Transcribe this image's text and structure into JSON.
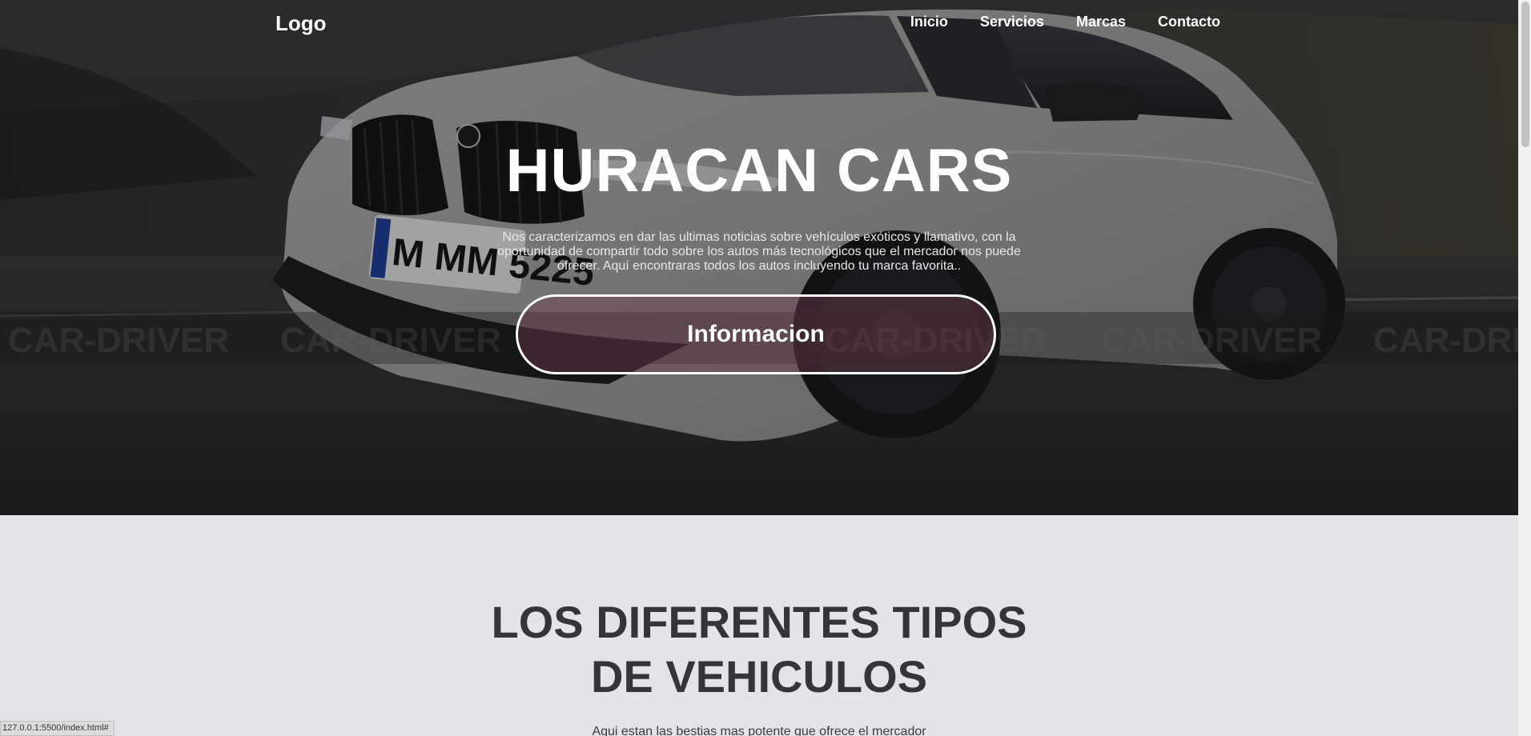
{
  "nav": {
    "logo": "Logo",
    "links": [
      {
        "label": "Inicio"
      },
      {
        "label": "Servicios"
      },
      {
        "label": "Marcas"
      },
      {
        "label": "Contacto"
      }
    ]
  },
  "hero": {
    "title": "HURACAN CARS",
    "description": "Nos caracterizamos en dar las ultimas noticias sobre vehículos exóticos y llamativo, con la oportunidad de compartir todo sobre los autos más tecnológicos que el mercador nos puede ofrecer. Aquí encontraras todos los autos incluyendo tu marca favorita..",
    "button_label": "Informacion",
    "plate_text": "M MM 5225",
    "watermark_text": "CAR-DRIVER"
  },
  "section": {
    "title_line1": "LOS DIFERENTES TIPOS",
    "title_line2": "DE VEHICULOS",
    "subtitle": "Aqui estan las bestias mas potente que ofrece el mercador"
  },
  "status_bar": {
    "url": "127.0.0.1:5500/index.html#"
  },
  "colors": {
    "hero_overlay": "#0f0f12",
    "button_fill": "#6e3c50",
    "section_bg": "#e2e4e8",
    "section_text": "#34353a"
  }
}
